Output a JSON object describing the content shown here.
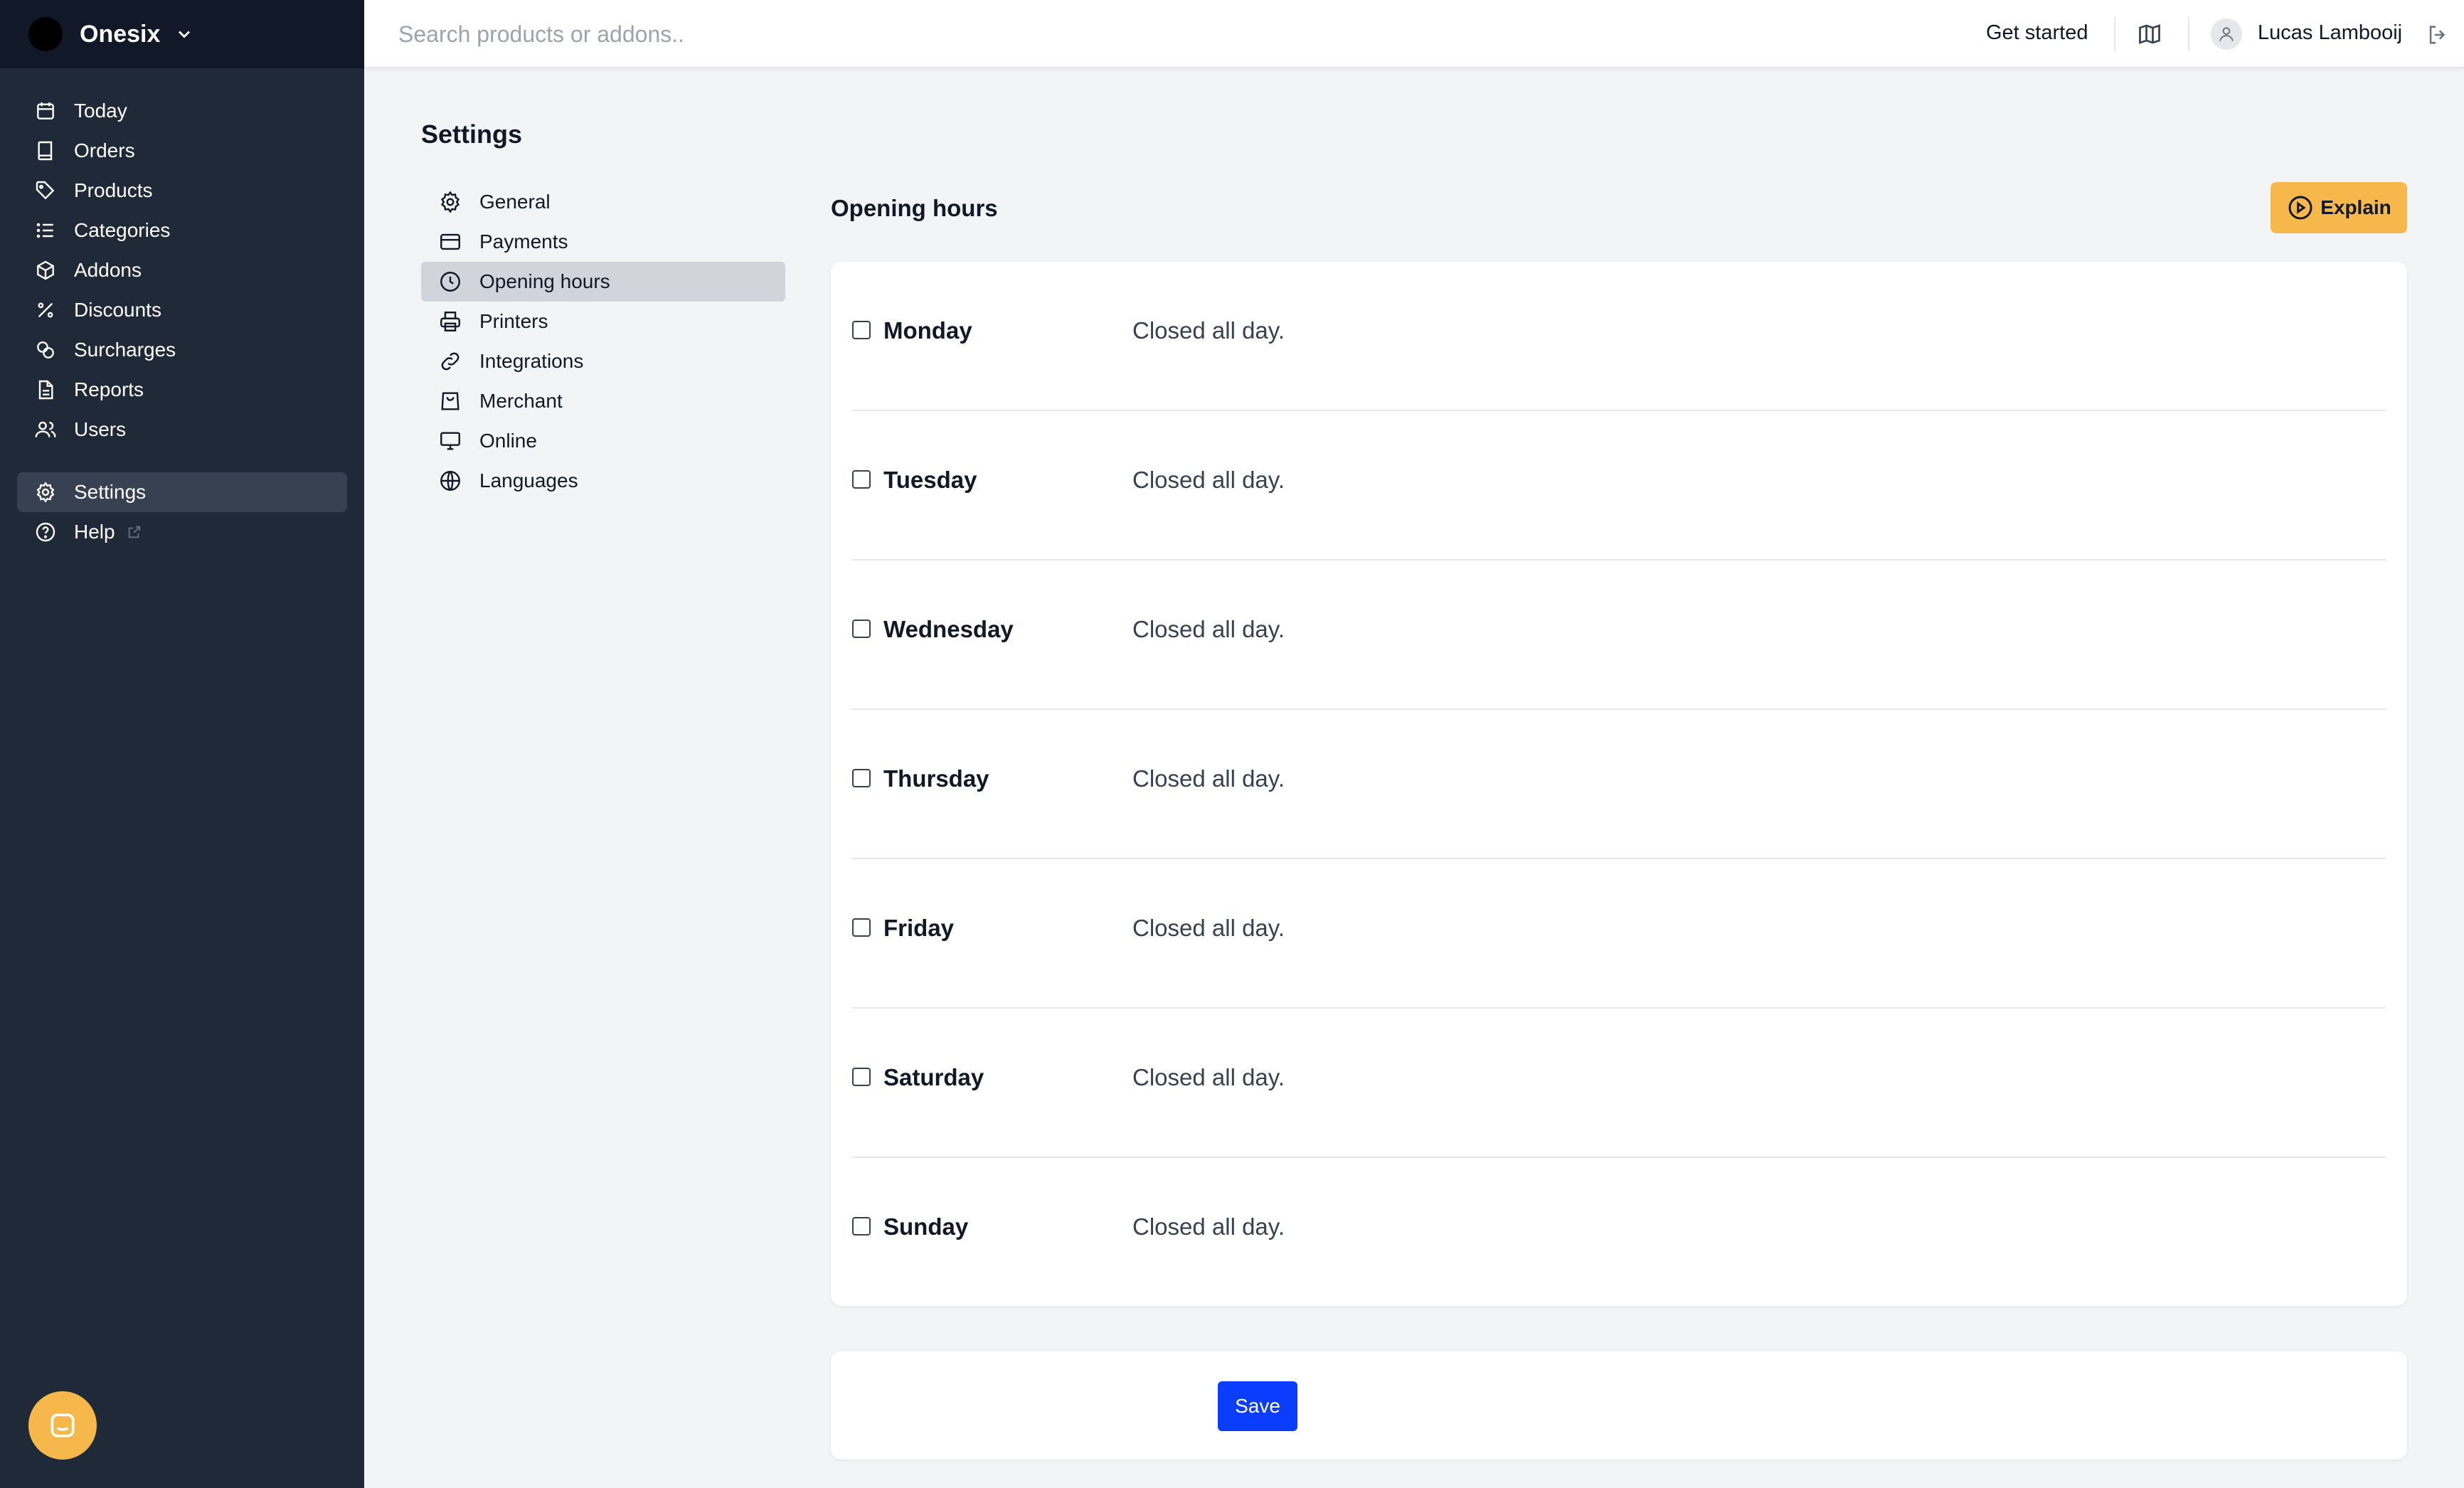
{
  "brand": {
    "name": "Onesix"
  },
  "sidebar": {
    "items": [
      {
        "label": "Today",
        "icon": "calendar-icon"
      },
      {
        "label": "Orders",
        "icon": "book-icon"
      },
      {
        "label": "Products",
        "icon": "tag-icon"
      },
      {
        "label": "Categories",
        "icon": "list-icon"
      },
      {
        "label": "Addons",
        "icon": "cube-icon"
      },
      {
        "label": "Discounts",
        "icon": "percent-icon"
      },
      {
        "label": "Surcharges",
        "icon": "coins-icon"
      },
      {
        "label": "Reports",
        "icon": "document-icon"
      },
      {
        "label": "Users",
        "icon": "users-icon"
      }
    ],
    "settings_label": "Settings",
    "help_label": "Help"
  },
  "topbar": {
    "search_placeholder": "Search products or addons..",
    "get_started": "Get started",
    "user_name": "Lucas Lambooij"
  },
  "page": {
    "title": "Settings",
    "section_title": "Opening hours",
    "explain_label": "Explain",
    "save_label": "Save"
  },
  "settings_nav": [
    {
      "label": "General",
      "icon": "gear-icon"
    },
    {
      "label": "Payments",
      "icon": "credit-card-icon"
    },
    {
      "label": "Opening hours",
      "icon": "clock-icon",
      "active": true
    },
    {
      "label": "Printers",
      "icon": "printer-icon"
    },
    {
      "label": "Integrations",
      "icon": "link-icon"
    },
    {
      "label": "Merchant",
      "icon": "shopping-bag-icon"
    },
    {
      "label": "Online",
      "icon": "monitor-icon"
    },
    {
      "label": "Languages",
      "icon": "globe-icon"
    }
  ],
  "days": [
    {
      "name": "Monday",
      "status": "Closed all day.",
      "checked": false
    },
    {
      "name": "Tuesday",
      "status": "Closed all day.",
      "checked": false
    },
    {
      "name": "Wednesday",
      "status": "Closed all day.",
      "checked": false
    },
    {
      "name": "Thursday",
      "status": "Closed all day.",
      "checked": false
    },
    {
      "name": "Friday",
      "status": "Closed all day.",
      "checked": false
    },
    {
      "name": "Saturday",
      "status": "Closed all day.",
      "checked": false
    },
    {
      "name": "Sunday",
      "status": "Closed all day.",
      "checked": false
    }
  ],
  "colors": {
    "sidebar_bg": "#1f2937",
    "accent_yellow": "#f6b84b",
    "primary_blue": "#0b3dff"
  }
}
